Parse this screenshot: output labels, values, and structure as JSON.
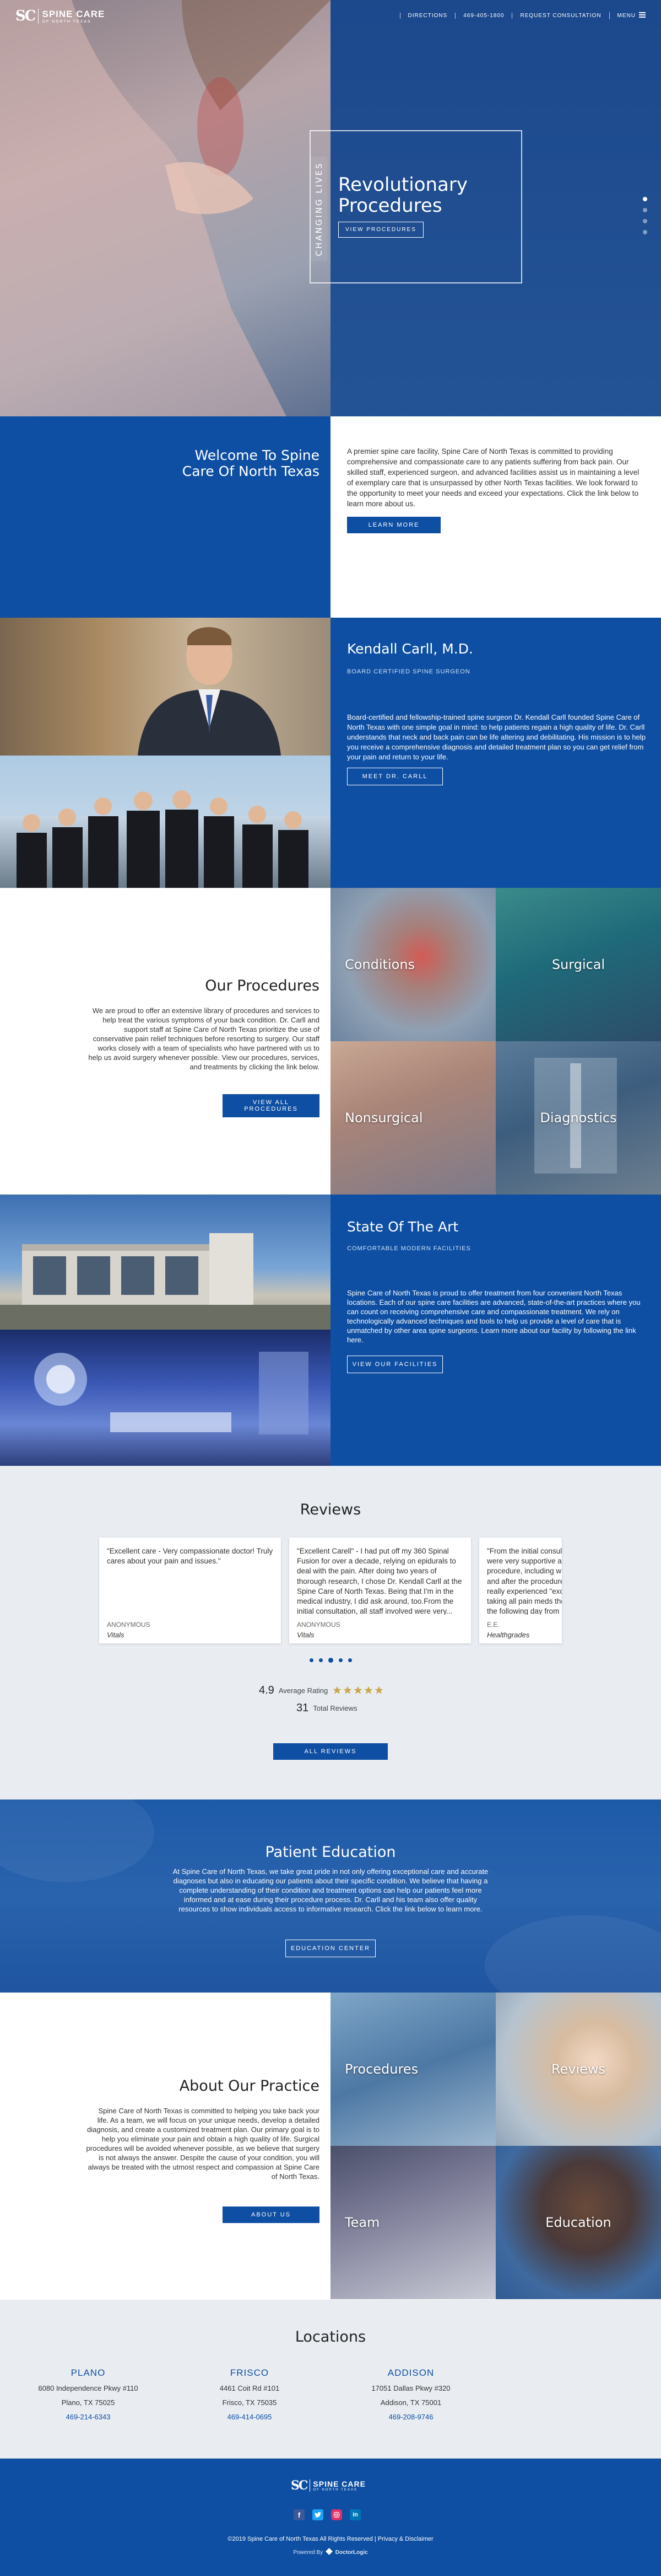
{
  "header": {
    "logo_mark": "SC",
    "logo_name": "SPINE CARE",
    "logo_sub": "OF NORTH TEXAS",
    "nav": [
      {
        "label": "DIRECTIONS"
      },
      {
        "label": "469-405-1800"
      },
      {
        "label": "REQUEST CONSULTATION"
      },
      {
        "label": "MENU"
      }
    ]
  },
  "hero": {
    "vertical_text": "CHANGING LIVES",
    "title": "Revolutionary Procedures",
    "button": "VIEW PROCEDURES",
    "slide_count": 4,
    "active_slide": 1
  },
  "welcome": {
    "title": "Welcome To Spine Care Of North Texas",
    "body": "A premier spine care facility, Spine Care of North Texas is committed to providing comprehensive and compassionate care to any patients suffering from back pain. Our skilled staff, experienced surgeon, and advanced facilities assist us in maintaining a level of exemplary care that is unsurpassed by other North Texas facilities. We look forward to the opportunity to meet your needs and exceed your expectations. Click the link below to learn more about us.",
    "button": "LEARN MORE"
  },
  "doctor": {
    "name": "Kendall Carll, M.D.",
    "subtitle": "BOARD CERTIFIED SPINE SURGEON",
    "body": "Board-certified and fellowship-trained spine surgeon Dr. Kendall Carll founded Spine Care of North Texas with one simple goal in mind: to help patients regain a high quality of life. Dr. Carll understands that neck and back pain can be life altering and debilitating. His mission is to help you receive a comprehensive diagnosis and detailed treatment plan so you can get relief from your pain and return to your life.",
    "button": "MEET DR. CARLL"
  },
  "procedures": {
    "title": "Our Procedures",
    "body": "We are proud to offer an extensive library of procedures and services to help treat the various symptoms of your back condition. Dr. Carll and support staff at Spine Care of North Texas prioritize the use of conservative pain relief techniques before resorting to surgery. Our staff works closely with a team of specialists who have partnered with us to help us avoid surgery whenever possible. View our procedures, services, and treatments by clicking the link below.",
    "button": "VIEW ALL PROCEDURES",
    "tiles": [
      {
        "label": "Conditions"
      },
      {
        "label": "Surgical"
      },
      {
        "label": "Nonsurgical"
      },
      {
        "label": "Diagnostics"
      }
    ]
  },
  "facility": {
    "title": "State Of The Art",
    "subtitle": "COMFORTABLE MODERN FACILITIES",
    "body": "Spine Care of North Texas is proud to offer treatment from four convenient North Texas locations. Each of our spine care facilities are advanced, state-of-the-art practices where you can count on receiving comprehensive care and compassionate treatment. We rely on technologically advanced techniques and tools to help us provide a level of care that is unmatched by other area spine surgeons. Learn more about our facility by following the link here.",
    "button": "VIEW OUR FACILITIES"
  },
  "reviews": {
    "title": "Reviews",
    "cards": [
      {
        "text": "\"Excellent care - Very compassionate doctor! Truly cares about your pain and issues.\"",
        "name": "ANONYMOUS",
        "source": "Vitals"
      },
      {
        "text": "\"Excellent Carell\" - I had put off my 360 Spinal Fusion for over a decade, relying on epidurals to deal with the pain. After doing two years of thorough research, I chose Dr. Kendall Carll at the Spine Care of North Texas. Being that I'm in the medical industry, I did ask around, too.From the initial consultation, all staff involved were very...",
        "name": "ANONYMOUS",
        "source": "Vitals"
      },
      {
        "text": "\"From the initial consultation, all staff involved were very supportive and took time to explain the procedure, including what to expect before, during and after the procedure. It is apparent that they really experienced \"excellent\" in caring for me and taking all pain meds they... I was up and walking the following day from my procedure. I was up and...",
        "name": "E.E.",
        "source": "Healthgrades"
      }
    ],
    "dots": 5,
    "active_dot": 3,
    "rating": "4.9",
    "rating_label": "Average Rating",
    "stars": 5,
    "total": "31",
    "total_label": "Total Reviews",
    "button": "ALL REVIEWS"
  },
  "education": {
    "title": "Patient Education",
    "body": "At Spine Care of North Texas, we take great pride in not only offering exceptional care and accurate diagnoses but also in educating our patients about their specific condition. We believe that having a complete understanding of their condition and treatment options can help our patients feel more informed and at ease during their procedure process. Dr. Carll and his team also offer quality resources to show individuals access to informative research. Click the link below to learn more.",
    "button": "EDUCATION CENTER"
  },
  "about": {
    "title": "About Our Practice",
    "body": "Spine Care of North Texas is committed to helping you take back your life. As a team, we will focus on your unique needs, develop a detailed diagnosis, and create a customized treatment plan. Our primary goal is to help you eliminate your pain and obtain a high quality of life. Surgical procedures will be avoided whenever possible, as we believe that surgery is not always the answer. Despite the cause of your condition, you will always be treated with the utmost respect and compassion at Spine Care of North Texas.",
    "button": "ABOUT US",
    "tiles": [
      {
        "label": "Procedures"
      },
      {
        "label": "Reviews"
      },
      {
        "label": "Team"
      },
      {
        "label": "Education"
      }
    ]
  },
  "locations": {
    "title": "Locations",
    "items": [
      {
        "name": "PLANO",
        "street": "6080 Independence Pkwy #110",
        "city": "Plano, TX 75025",
        "phone": "469-214-6343"
      },
      {
        "name": "FRISCO",
        "street": "4461 Coit Rd #101",
        "city": "Frisco, TX 75035",
        "phone": "469-414-0695"
      },
      {
        "name": "ADDISON",
        "street": "17051 Dallas Pkwy #320",
        "city": "Addison, TX 75001",
        "phone": "469-208-9746"
      }
    ]
  },
  "footer": {
    "logo_mark": "SC",
    "logo_name": "SPINE CARE",
    "logo_sub": "OF NORTH TEXAS",
    "copyright": "©2019 Spine Care of North Texas All Rights Reserved | Privacy & Disclaimer",
    "powered": "Powered By",
    "powered_brand": "DoctorLogic",
    "social": [
      "facebook-icon",
      "twitter-icon",
      "instagram-icon",
      "linkedin-icon"
    ]
  },
  "colors": {
    "primary": "#0e4fa3",
    "reviews_bg": "#e9edf2",
    "star": "#c9a84c"
  }
}
